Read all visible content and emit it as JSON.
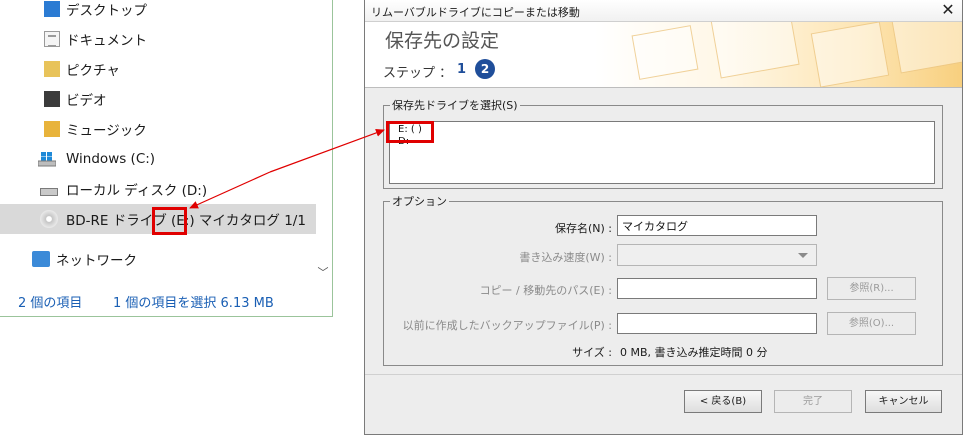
{
  "explorer": {
    "nav_items": [
      {
        "label": "デスクトップ",
        "icon": "desktop-folder-icon"
      },
      {
        "label": "ドキュメント",
        "icon": "documents-folder-icon"
      },
      {
        "label": "ピクチャ",
        "icon": "pictures-folder-icon"
      },
      {
        "label": "ビデオ",
        "icon": "videos-folder-icon"
      },
      {
        "label": "ミュージック",
        "icon": "music-folder-icon"
      },
      {
        "label": "Windows (C:)",
        "icon": "windows-drive-icon"
      },
      {
        "label": "ローカル ディスク (D:)",
        "icon": "hard-disk-icon"
      },
      {
        "label": "BD-RE ドライブ (E:) マイカタログ 1/1",
        "icon": "optical-disc-icon"
      },
      {
        "label": "ネットワーク",
        "icon": "network-icon"
      }
    ],
    "selected_index": 7,
    "status": {
      "item_count": "2 個の項目",
      "selection": "1 個の項目を選択  6.13 MB"
    },
    "scroll_down_glyph": "﹀"
  },
  "dialog": {
    "title": "リムーバブルドライブにコピーまたは移動",
    "close_glyph": "✕",
    "header": {
      "title": "保存先の設定",
      "step_label": "ステップ ：",
      "step1": "1",
      "step2": "2"
    },
    "destination": {
      "legend": "保存先ドライブを選択(S)",
      "drives": [
        "E: ( )",
        "D:"
      ]
    },
    "options": {
      "legend": "オプション",
      "save_name_label": "保存名(N) :",
      "save_name_value": "マイカタログ",
      "write_speed_label": "書き込み速度(W) :",
      "copy_path_label": "コピー / 移動先のパス(E) :",
      "copy_path_value": "",
      "browse1": "参照(R)...",
      "backup_label": "以前に作成したバックアップファイル(P) :",
      "backup_value": "",
      "browse2": "参照(O)...",
      "size_label": "サイズ :",
      "size_value": "0 MB, 書き込み推定時間 0 分"
    },
    "buttons": {
      "back": "< 戻る(B)",
      "finish": "完了",
      "cancel": "キャンセル"
    }
  },
  "annotation_color": "#e00000"
}
